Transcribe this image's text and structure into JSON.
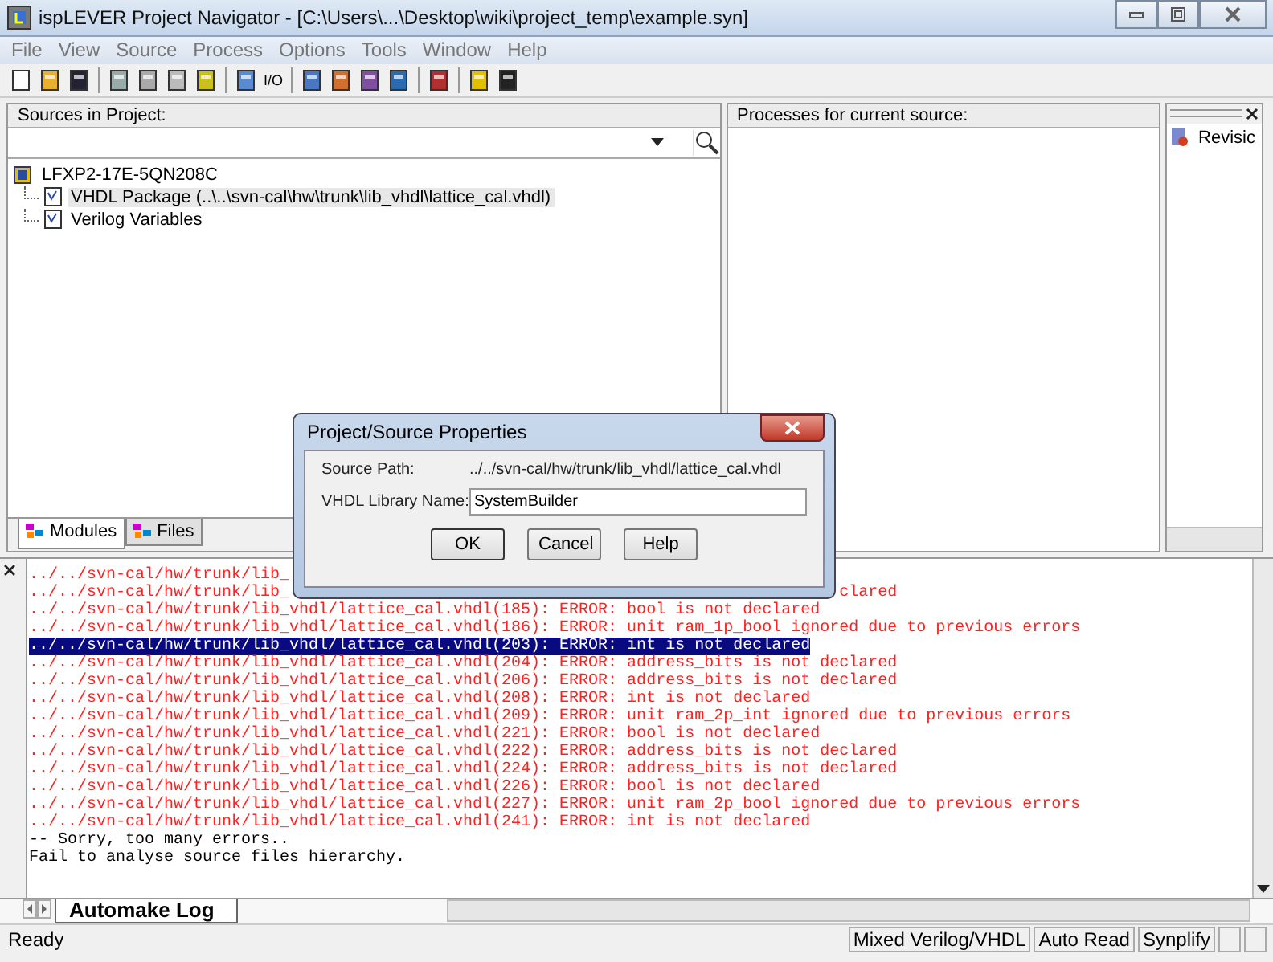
{
  "window": {
    "title": "ispLEVER Project Navigator - [C:\\Users\\...\\Desktop\\wiki\\project_temp\\example.syn]"
  },
  "menu": [
    "File",
    "View",
    "Source",
    "Process",
    "Options",
    "Tools",
    "Window",
    "Help"
  ],
  "toolbar": {
    "io_label": "I/O"
  },
  "sources": {
    "title": "Sources in Project:",
    "tree": [
      {
        "label": "LFXP2-17E-5QN208C",
        "selected": false,
        "children": [
          {
            "label": "VHDL Package (..\\..\\svn-cal\\hw\\trunk\\lib_vhdl\\lattice_cal.vhdl)",
            "selected": true
          },
          {
            "label": "Verilog Variables",
            "selected": false
          }
        ]
      }
    ],
    "tabs": [
      {
        "label": "Modules",
        "selected": true
      },
      {
        "label": "Files",
        "selected": false
      }
    ]
  },
  "processes": {
    "title": "Processes for current source:"
  },
  "revisions": {
    "items": [
      "Revisic"
    ]
  },
  "log": {
    "lines": [
      {
        "kind": "error",
        "text": "../../svn-cal/hw/trunk/lib_",
        "selected": false
      },
      {
        "kind": "split",
        "text": "../../svn-cal/hw/trunk/lib_",
        "tail": "clared",
        "selected": false
      },
      {
        "kind": "error",
        "text": "../../svn-cal/hw/trunk/lib_vhdl/lattice_cal.vhdl(185): ERROR: bool is not declared",
        "selected": false
      },
      {
        "kind": "error",
        "text": "../../svn-cal/hw/trunk/lib_vhdl/lattice_cal.vhdl(186): ERROR: unit ram_1p_bool ignored due to previous errors",
        "selected": false
      },
      {
        "kind": "error",
        "text": "../../svn-cal/hw/trunk/lib_vhdl/lattice_cal.vhdl(203): ERROR: int is not declared",
        "selected": true
      },
      {
        "kind": "error",
        "text": "../../svn-cal/hw/trunk/lib_vhdl/lattice_cal.vhdl(204): ERROR: address_bits is not declared",
        "selected": false
      },
      {
        "kind": "error",
        "text": "../../svn-cal/hw/trunk/lib_vhdl/lattice_cal.vhdl(206): ERROR: address_bits is not declared",
        "selected": false
      },
      {
        "kind": "error",
        "text": "../../svn-cal/hw/trunk/lib_vhdl/lattice_cal.vhdl(208): ERROR: int is not declared",
        "selected": false
      },
      {
        "kind": "error",
        "text": "../../svn-cal/hw/trunk/lib_vhdl/lattice_cal.vhdl(209): ERROR: unit ram_2p_int ignored due to previous errors",
        "selected": false
      },
      {
        "kind": "error",
        "text": "../../svn-cal/hw/trunk/lib_vhdl/lattice_cal.vhdl(221): ERROR: bool is not declared",
        "selected": false
      },
      {
        "kind": "error",
        "text": "../../svn-cal/hw/trunk/lib_vhdl/lattice_cal.vhdl(222): ERROR: address_bits is not declared",
        "selected": false
      },
      {
        "kind": "error",
        "text": "../../svn-cal/hw/trunk/lib_vhdl/lattice_cal.vhdl(224): ERROR: address_bits is not declared",
        "selected": false
      },
      {
        "kind": "error",
        "text": "../../svn-cal/hw/trunk/lib_vhdl/lattice_cal.vhdl(226): ERROR: bool is not declared",
        "selected": false
      },
      {
        "kind": "error",
        "text": "../../svn-cal/hw/trunk/lib_vhdl/lattice_cal.vhdl(227): ERROR: unit ram_2p_bool ignored due to previous errors",
        "selected": false
      },
      {
        "kind": "error",
        "text": "../../svn-cal/hw/trunk/lib_vhdl/lattice_cal.vhdl(241): ERROR: int is not declared",
        "selected": false
      },
      {
        "kind": "info",
        "text": "-- Sorry, too many errors..",
        "selected": false
      },
      {
        "kind": "info",
        "text": "Fail to analyse source files hierarchy.",
        "selected": false
      }
    ],
    "tabs": [
      {
        "label": "Automake Log",
        "selected": true
      }
    ]
  },
  "status_bar": [
    "Ready",
    "Mixed Verilog/VHDL",
    "Auto Read",
    "Synplify"
  ],
  "dialog": {
    "title": "Project/Source Properties",
    "source_path_label": "Source Path:",
    "source_path": "../../svn-cal/hw/trunk/lib_vhdl/lattice_cal.vhdl",
    "library_label": "VHDL Library Name:",
    "library_value": "SystemBuilder",
    "buttons": [
      "OK",
      "Cancel",
      "Help"
    ]
  }
}
